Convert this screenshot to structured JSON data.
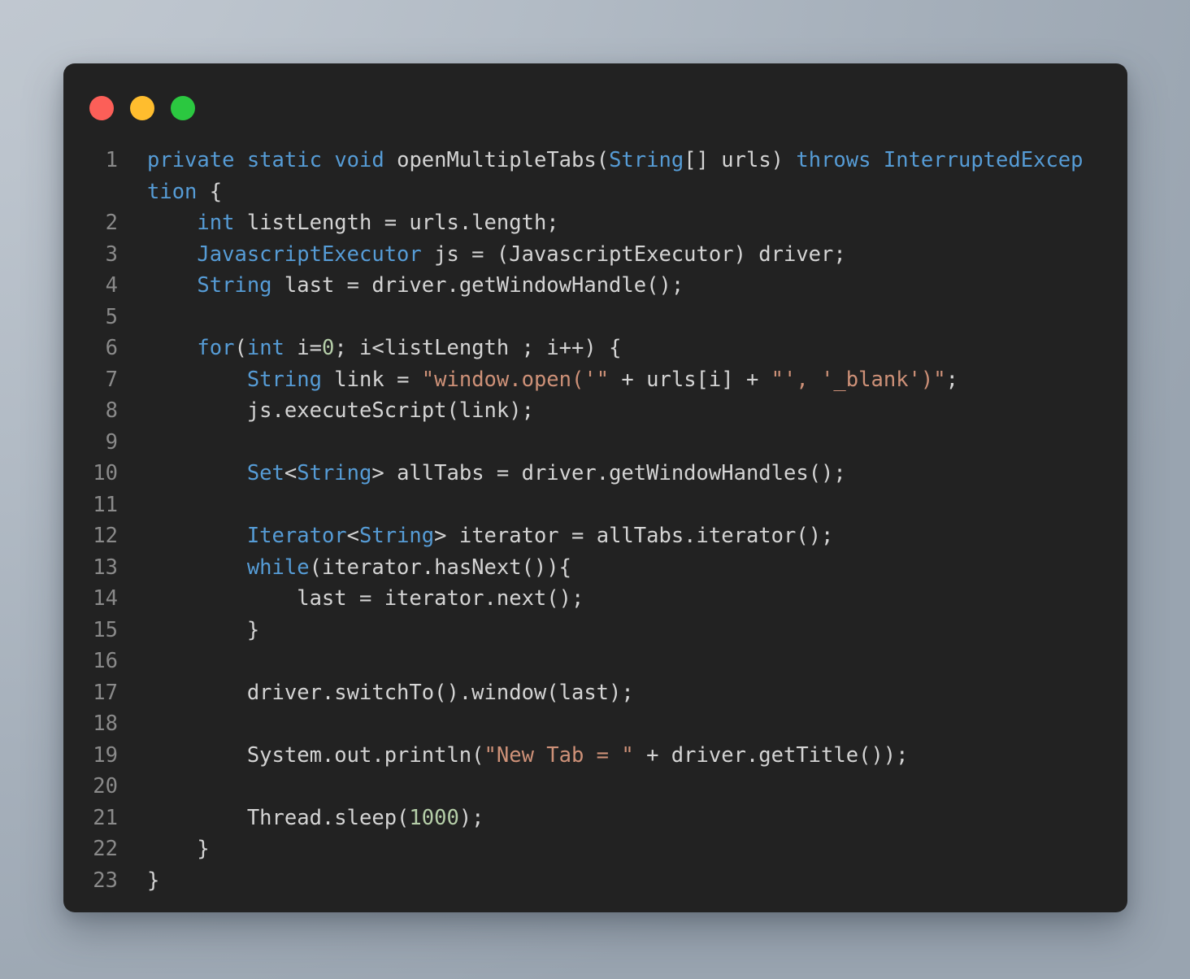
{
  "window": {
    "background_color": "#b4bdc7",
    "surface_color": "#222222",
    "controls": [
      {
        "name": "close",
        "color": "#fc5f58"
      },
      {
        "name": "minimize",
        "color": "#ffbd2e"
      },
      {
        "name": "maximize",
        "color": "#2bc840"
      }
    ]
  },
  "theme": {
    "keyword_color": "#569cd6",
    "string_color": "#ce9178",
    "number_color": "#b5cea8",
    "plain_color": "#d4d4d4",
    "gutter_color": "#8a8a8a"
  },
  "editor": {
    "language": "java",
    "line_numbers": [
      "1",
      "2",
      "3",
      "4",
      "5",
      "6",
      "7",
      "8",
      "9",
      "10",
      "11",
      "12",
      "13",
      "14",
      "15",
      "16",
      "17",
      "18",
      "19",
      "20",
      "21",
      "22",
      "23"
    ],
    "lines": [
      {
        "number": "1",
        "text": "private static void openMultipleTabs(String[] urls) throws InterruptedException {",
        "wrapped": true,
        "segments": [
          {
            "t": "private",
            "c": "kw"
          },
          {
            "t": " ",
            "c": "pln"
          },
          {
            "t": "static",
            "c": "kw"
          },
          {
            "t": " ",
            "c": "pln"
          },
          {
            "t": "void",
            "c": "kw"
          },
          {
            "t": " openMultipleTabs(",
            "c": "pln"
          },
          {
            "t": "String",
            "c": "kw"
          },
          {
            "t": "[] urls) ",
            "c": "pln"
          },
          {
            "t": "throws",
            "c": "kw"
          },
          {
            "t": " ",
            "c": "pln"
          },
          {
            "t": "InterruptedExcep",
            "c": "kw"
          }
        ],
        "continuation_segments": [
          {
            "t": "tion",
            "c": "kw"
          },
          {
            "t": " {",
            "c": "pln"
          }
        ]
      },
      {
        "number": "2",
        "text": "    int listLength = urls.length;",
        "segments": [
          {
            "t": "    ",
            "c": "pln"
          },
          {
            "t": "int",
            "c": "kw"
          },
          {
            "t": " listLength = urls.length;",
            "c": "pln"
          }
        ]
      },
      {
        "number": "3",
        "text": "    JavascriptExecutor js = (JavascriptExecutor) driver;",
        "segments": [
          {
            "t": "    ",
            "c": "pln"
          },
          {
            "t": "JavascriptExecutor",
            "c": "kw"
          },
          {
            "t": " js = (JavascriptExecutor) driver;",
            "c": "pln"
          }
        ]
      },
      {
        "number": "4",
        "text": "    String last = driver.getWindowHandle();",
        "segments": [
          {
            "t": "    ",
            "c": "pln"
          },
          {
            "t": "String",
            "c": "kw"
          },
          {
            "t": " last = driver.getWindowHandle();",
            "c": "pln"
          }
        ]
      },
      {
        "number": "5",
        "text": "",
        "segments": []
      },
      {
        "number": "6",
        "text": "    for(int i=0; i<listLength ; i++) {",
        "segments": [
          {
            "t": "    ",
            "c": "pln"
          },
          {
            "t": "for",
            "c": "kw"
          },
          {
            "t": "(",
            "c": "pln"
          },
          {
            "t": "int",
            "c": "kw"
          },
          {
            "t": " i=",
            "c": "pln"
          },
          {
            "t": "0",
            "c": "num"
          },
          {
            "t": "; i<listLength ; i++) {",
            "c": "pln"
          }
        ]
      },
      {
        "number": "7",
        "text": "        String link = \"window.open('\" + urls[i] + \"', '_blank')\";",
        "segments": [
          {
            "t": "        ",
            "c": "pln"
          },
          {
            "t": "String",
            "c": "kw"
          },
          {
            "t": " link = ",
            "c": "pln"
          },
          {
            "t": "\"window.open('\"",
            "c": "str"
          },
          {
            "t": " + urls[i] + ",
            "c": "pln"
          },
          {
            "t": "\"', '_blank')\"",
            "c": "str"
          },
          {
            "t": ";",
            "c": "pln"
          }
        ]
      },
      {
        "number": "8",
        "text": "        js.executeScript(link);",
        "segments": [
          {
            "t": "        js.executeScript(link);",
            "c": "pln"
          }
        ]
      },
      {
        "number": "9",
        "text": "",
        "segments": []
      },
      {
        "number": "10",
        "text": "        Set<String> allTabs = driver.getWindowHandles();",
        "segments": [
          {
            "t": "        ",
            "c": "pln"
          },
          {
            "t": "Set",
            "c": "kw"
          },
          {
            "t": "<",
            "c": "pln"
          },
          {
            "t": "String",
            "c": "kw"
          },
          {
            "t": "> allTabs = driver.getWindowHandles();",
            "c": "pln"
          }
        ]
      },
      {
        "number": "11",
        "text": "",
        "segments": []
      },
      {
        "number": "12",
        "text": "        Iterator<String> iterator = allTabs.iterator();",
        "segments": [
          {
            "t": "        ",
            "c": "pln"
          },
          {
            "t": "Iterator",
            "c": "kw"
          },
          {
            "t": "<",
            "c": "pln"
          },
          {
            "t": "String",
            "c": "kw"
          },
          {
            "t": "> iterator = allTabs.iterator();",
            "c": "pln"
          }
        ]
      },
      {
        "number": "13",
        "text": "        while(iterator.hasNext()){",
        "segments": [
          {
            "t": "        ",
            "c": "pln"
          },
          {
            "t": "while",
            "c": "kw"
          },
          {
            "t": "(iterator.hasNext()){",
            "c": "pln"
          }
        ]
      },
      {
        "number": "14",
        "text": "            last = iterator.next();",
        "segments": [
          {
            "t": "            last = iterator.next();",
            "c": "pln"
          }
        ]
      },
      {
        "number": "15",
        "text": "        }",
        "segments": [
          {
            "t": "        }",
            "c": "pln"
          }
        ]
      },
      {
        "number": "16",
        "text": "",
        "segments": []
      },
      {
        "number": "17",
        "text": "        driver.switchTo().window(last);",
        "segments": [
          {
            "t": "        driver.switchTo().window(last);",
            "c": "pln"
          }
        ]
      },
      {
        "number": "18",
        "text": "",
        "segments": []
      },
      {
        "number": "19",
        "text": "        System.out.println(\"New Tab = \" + driver.getTitle());",
        "segments": [
          {
            "t": "        System.out.println(",
            "c": "pln"
          },
          {
            "t": "\"New Tab = \"",
            "c": "str"
          },
          {
            "t": " + driver.getTitle());",
            "c": "pln"
          }
        ]
      },
      {
        "number": "20",
        "text": "",
        "segments": []
      },
      {
        "number": "21",
        "text": "        Thread.sleep(1000);",
        "segments": [
          {
            "t": "        Thread.sleep(",
            "c": "pln"
          },
          {
            "t": "1000",
            "c": "num"
          },
          {
            "t": ");",
            "c": "pln"
          }
        ]
      },
      {
        "number": "22",
        "text": "    }",
        "segments": [
          {
            "t": "    }",
            "c": "pln"
          }
        ]
      },
      {
        "number": "23",
        "text": "}",
        "segments": [
          {
            "t": "}",
            "c": "pln"
          }
        ]
      }
    ]
  }
}
